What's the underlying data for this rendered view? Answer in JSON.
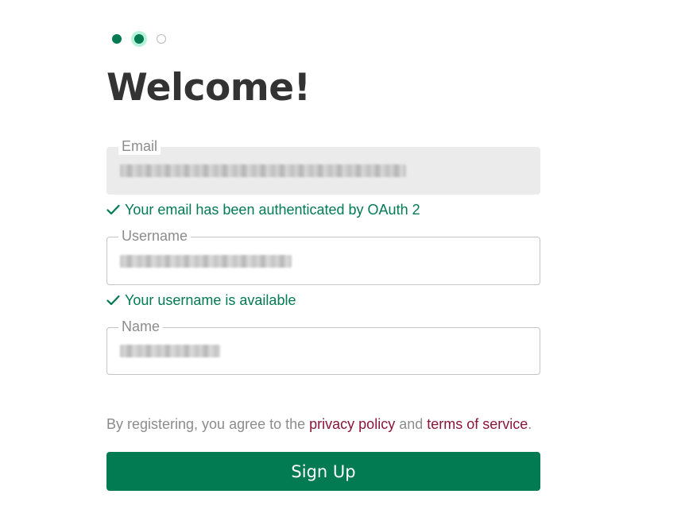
{
  "steps": [
    {
      "state": "done"
    },
    {
      "state": "current"
    },
    {
      "state": "pending"
    }
  ],
  "title": "Welcome!",
  "email": {
    "label": "Email",
    "value": "••••••••••••••••••••••••",
    "hint": "Your email has been authenticated by OAuth 2"
  },
  "username": {
    "label": "Username",
    "value": "•••••••••••••••",
    "hint": "Your username is available"
  },
  "name": {
    "label": "Name",
    "value": "••••••••"
  },
  "agreement": {
    "prefix": "By registering, you agree to the ",
    "privacy_link": "privacy policy",
    "middle": " and ",
    "terms_link": "terms of service",
    "suffix": "."
  },
  "signup_button": "Sign Up",
  "colors": {
    "accent": "#027a52",
    "link": "#8a1538",
    "muted": "#8c8c8c",
    "title": "#333333"
  }
}
